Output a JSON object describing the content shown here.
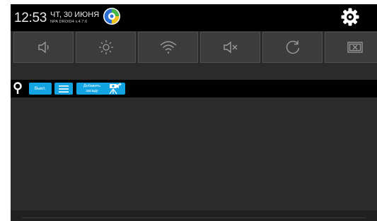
{
  "status_bar": {
    "time": "12:53",
    "date": "ЧТ, 30 ИЮНЯ",
    "version": "NPA DROID4 v.4.7.6",
    "app_icon": "app-logo-icon",
    "settings_icon": "gear-icon"
  },
  "quick_toggles": [
    {
      "name": "volume-icon"
    },
    {
      "name": "brightness-icon"
    },
    {
      "name": "wifi-icon"
    },
    {
      "name": "mute-icon"
    },
    {
      "name": "rotate-icon"
    },
    {
      "name": "close-window-icon"
    }
  ],
  "toolbar": {
    "pin_icon": "map-pin-icon",
    "off_label": "Выкл.",
    "menu_icon": "hamburger-menu-icon",
    "add_line1": "Добавить",
    "add_line2": "засаду",
    "add_icon": "camera-tripod-icon"
  },
  "colors": {
    "accent": "#11a3e2",
    "background": "#2b2b2b",
    "status_bar": "#000000",
    "tile": "#3c3c3c"
  }
}
